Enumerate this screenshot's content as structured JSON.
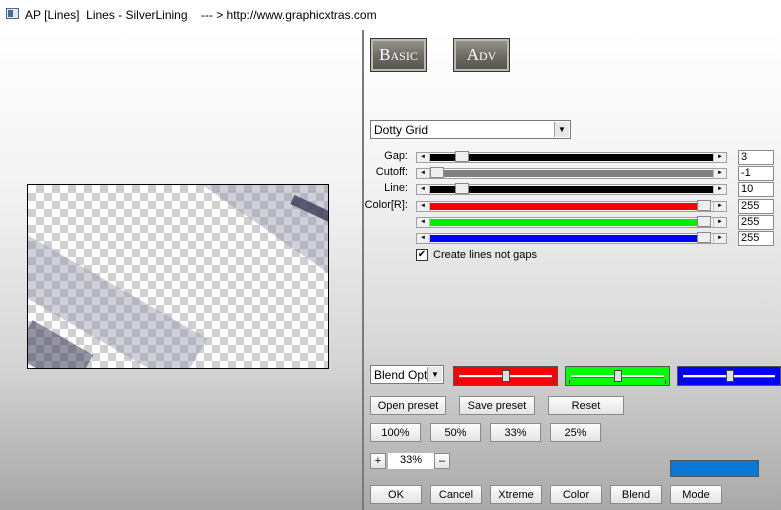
{
  "window": {
    "title": "AP [Lines]  Lines - SilverLining    --- > http://www.graphicxtras.com"
  },
  "modes": {
    "basic": "Basic",
    "adv": "Adv"
  },
  "preset": {
    "selected": "Dotty Grid"
  },
  "params": [
    {
      "label": "Gap:",
      "value": "3",
      "fill_color": "#000000",
      "fill_fraction": 0.04
    },
    {
      "label": "Cutoff:",
      "value": "-1",
      "fill_color": "#808080",
      "fill_fraction": 0.0
    },
    {
      "label": "Line:",
      "value": "10",
      "fill_color": "#000000",
      "fill_fraction": 0.04
    },
    {
      "label": "Color[R]:",
      "value": "255",
      "fill_color": "#ff0000",
      "fill_fraction": 1.0
    },
    {
      "label": "",
      "value": "255",
      "fill_color": "#00ee00",
      "fill_fraction": 1.0
    },
    {
      "label": "",
      "value": "255",
      "fill_color": "#0000ff",
      "fill_fraction": 1.0
    }
  ],
  "option": {
    "label": "Create lines not gaps",
    "checked": true,
    "mark": "✔"
  },
  "blend": {
    "selected": "Blend Optio"
  },
  "channel_sliders": [
    {
      "name": "red",
      "color": "#ff0000",
      "level": 0.5
    },
    {
      "name": "green",
      "color": "#00ff00",
      "level": 0.5
    },
    {
      "name": "blue",
      "color": "#0000ff",
      "level": 0.5
    }
  ],
  "preset_buttons": {
    "open": "Open preset",
    "save": "Save preset",
    "reset": "Reset"
  },
  "zoom_buttons": [
    "100%",
    "50%",
    "33%",
    "25%"
  ],
  "zoom": {
    "plus": "+",
    "value": "33%",
    "minus": "–"
  },
  "swatch_color": "#0a78d7",
  "bottom_buttons": {
    "ok": "OK",
    "cancel": "Cancel",
    "xtreme": "Xtreme",
    "color": "Color",
    "blend": "Blend",
    "mode": "Mode"
  }
}
